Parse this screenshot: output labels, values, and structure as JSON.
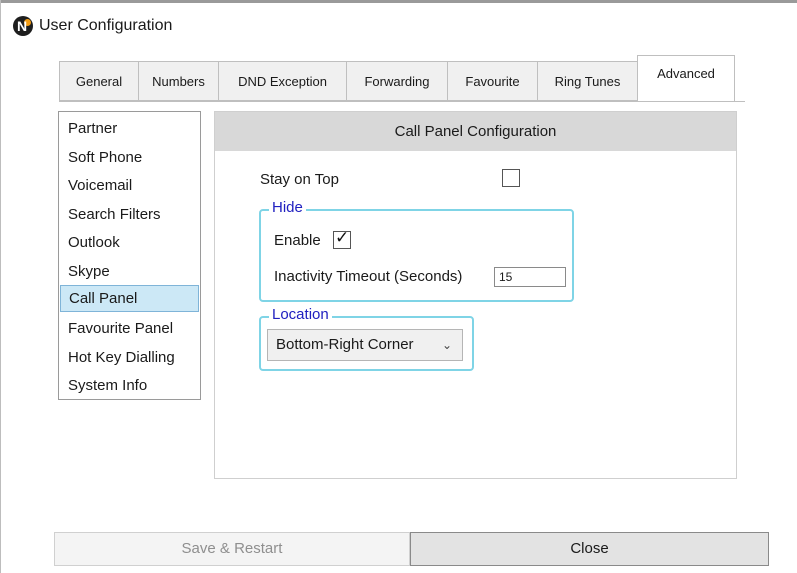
{
  "window": {
    "title": "User Configuration",
    "logo_icon": "n-logo-icon"
  },
  "tabs": [
    {
      "label": "General"
    },
    {
      "label": "Numbers"
    },
    {
      "label": "DND Exception"
    },
    {
      "label": "Forwarding"
    },
    {
      "label": "Favourite"
    },
    {
      "label": "Ring Tunes"
    },
    {
      "label": "Advanced",
      "active": true
    }
  ],
  "sidebar": {
    "items": [
      {
        "label": "Partner"
      },
      {
        "label": "Soft Phone"
      },
      {
        "label": "Voicemail"
      },
      {
        "label": "Search Filters"
      },
      {
        "label": "Outlook"
      },
      {
        "label": "Skype"
      },
      {
        "label": "Call Panel",
        "selected": true
      },
      {
        "label": "Favourite Panel"
      },
      {
        "label": "Hot Key Dialling"
      },
      {
        "label": "System Info"
      }
    ]
  },
  "panel": {
    "header": "Call Panel Configuration",
    "stay_on_top": {
      "label": "Stay on Top",
      "checked": false
    },
    "hide_group": {
      "legend": "Hide",
      "enable": {
        "label": "Enable",
        "checked": true,
        "tick": "✓"
      },
      "timeout": {
        "label": "Inactivity Timeout (Seconds)",
        "value": "15"
      }
    },
    "location_group": {
      "legend": "Location",
      "selected": "Bottom-Right Corner",
      "chevron": "⌄"
    }
  },
  "footer": {
    "save_label": "Save & Restart",
    "save_enabled": false,
    "close_label": "Close"
  },
  "colors": {
    "accent_border": "#7fd4e6",
    "legend_text": "#2020c0",
    "selected_item_bg": "#cce8f6"
  }
}
